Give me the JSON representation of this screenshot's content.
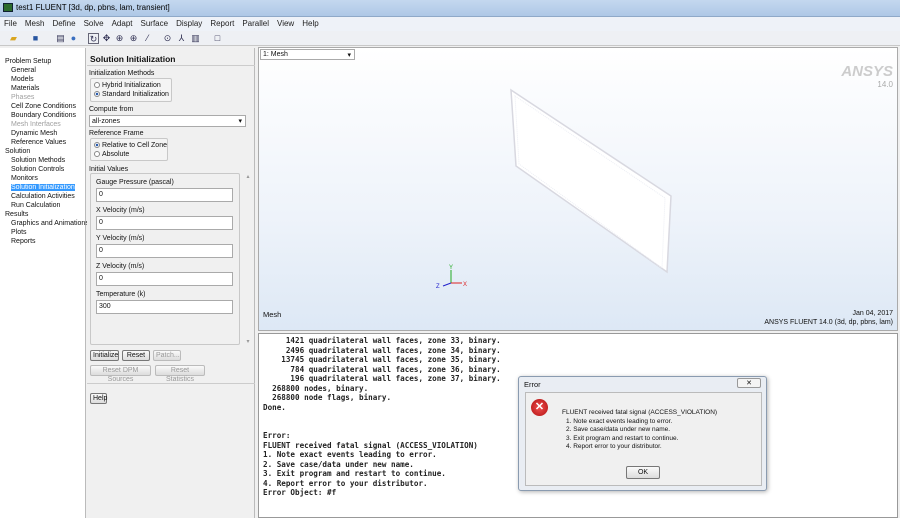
{
  "window": {
    "title": "test1 FLUENT  [3d, dp, pbns, lam, transient]"
  },
  "menu": [
    "File",
    "Mesh",
    "Define",
    "Solve",
    "Adapt",
    "Surface",
    "Display",
    "Report",
    "Parallel",
    "View",
    "Help"
  ],
  "tree": [
    {
      "label": "Problem Setup",
      "level": 0
    },
    {
      "label": "General",
      "level": 1
    },
    {
      "label": "Models",
      "level": 1
    },
    {
      "label": "Materials",
      "level": 1
    },
    {
      "label": "Phases",
      "level": 1,
      "disabled": true
    },
    {
      "label": "Cell Zone Conditions",
      "level": 1
    },
    {
      "label": "Boundary Conditions",
      "level": 1
    },
    {
      "label": "Mesh Interfaces",
      "level": 1,
      "disabled": true
    },
    {
      "label": "Dynamic Mesh",
      "level": 1
    },
    {
      "label": "Reference Values",
      "level": 1
    },
    {
      "label": "Solution",
      "level": 0
    },
    {
      "label": "Solution Methods",
      "level": 1
    },
    {
      "label": "Solution Controls",
      "level": 1
    },
    {
      "label": "Monitors",
      "level": 1
    },
    {
      "label": "Solution Initialization",
      "level": 1,
      "selected": true
    },
    {
      "label": "Calculation Activities",
      "level": 1
    },
    {
      "label": "Run Calculation",
      "level": 1
    },
    {
      "label": "Results",
      "level": 0
    },
    {
      "label": "Graphics and Animations",
      "level": 1
    },
    {
      "label": "Plots",
      "level": 1
    },
    {
      "label": "Reports",
      "level": 1
    }
  ],
  "task": {
    "title": "Solution Initialization",
    "init_methods_label": "Initialization Methods",
    "hybrid": "Hybrid  Initialization",
    "standard": "Standard Initialization",
    "compute_from_label": "Compute from",
    "compute_from_value": "all-zones",
    "ref_frame_label": "Reference Frame",
    "relative": "Relative to Cell Zone",
    "absolute": "Absolute",
    "initial_values_label": "Initial Values",
    "fields": [
      {
        "label": "Gauge Pressure (pascal)",
        "value": "0"
      },
      {
        "label": "X Velocity (m/s)",
        "value": "0"
      },
      {
        "label": "Y Velocity (m/s)",
        "value": "0"
      },
      {
        "label": "Z Velocity (m/s)",
        "value": "0"
      },
      {
        "label": "Temperature (k)",
        "value": "300"
      }
    ],
    "initialize": "Initialize",
    "reset": "Reset",
    "patch": "Patch...",
    "reset_dpm": "Reset DPM Sources",
    "reset_stats": "Reset Statistics",
    "help": "Help"
  },
  "graphics": {
    "window_select": "1: Mesh",
    "logo": "ANSYS",
    "version": "14.0",
    "label": "Mesh",
    "date": "Jan 04, 2017",
    "info": "ANSYS FLUENT 14.0 (3d, dp, pbns, lam)",
    "axes": {
      "x": "X",
      "y": "Y",
      "z": "Z"
    }
  },
  "console": [
    "     1421 quadrilateral wall faces, zone 33, binary.",
    "     2496 quadrilateral wall faces, zone 34, binary.",
    "    13745 quadrilateral wall faces, zone 35, binary.",
    "      784 quadrilateral wall faces, zone 36, binary.",
    "      196 quadrilateral wall faces, zone 37, binary.",
    "  268800 nodes, binary.",
    "  268800 node flags, binary.",
    "Done.",
    "",
    "",
    "Error:",
    "FLUENT received fatal signal (ACCESS_VIOLATION)",
    "1. Note exact events leading to error.",
    "2. Save case/data under new name.",
    "3. Exit program and restart to continue.",
    "4. Report error to your distributor.",
    "Error Object: #f"
  ],
  "dialog": {
    "title": "Error",
    "lines": [
      "FLUENT received fatal signal (ACCESS_VIOLATION)",
      "1. Note exact events leading to error.",
      "2. Save case/data under new name.",
      "3. Exit program and restart to continue.",
      "4. Report error to your distributor."
    ],
    "ok": "OK"
  }
}
